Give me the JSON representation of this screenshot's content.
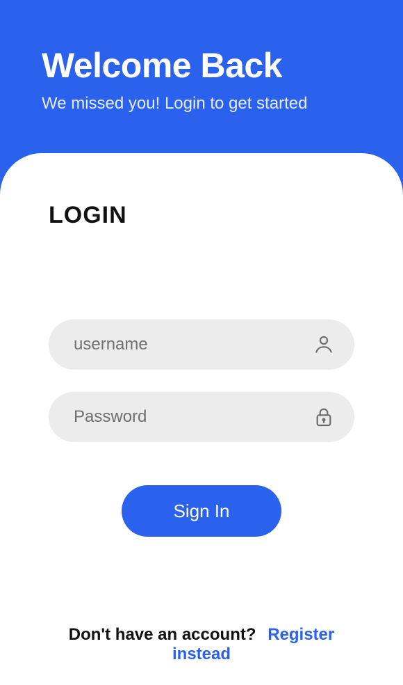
{
  "header": {
    "title": "Welcome Back",
    "subtitle": "We missed you! Login to get started"
  },
  "card": {
    "heading": "LOGIN"
  },
  "fields": {
    "username": {
      "placeholder": "username",
      "value": ""
    },
    "password": {
      "placeholder": "Password",
      "value": ""
    }
  },
  "signin_label": "Sign In",
  "footer": {
    "prompt": "Don't have an account?",
    "link": "Register instead"
  }
}
